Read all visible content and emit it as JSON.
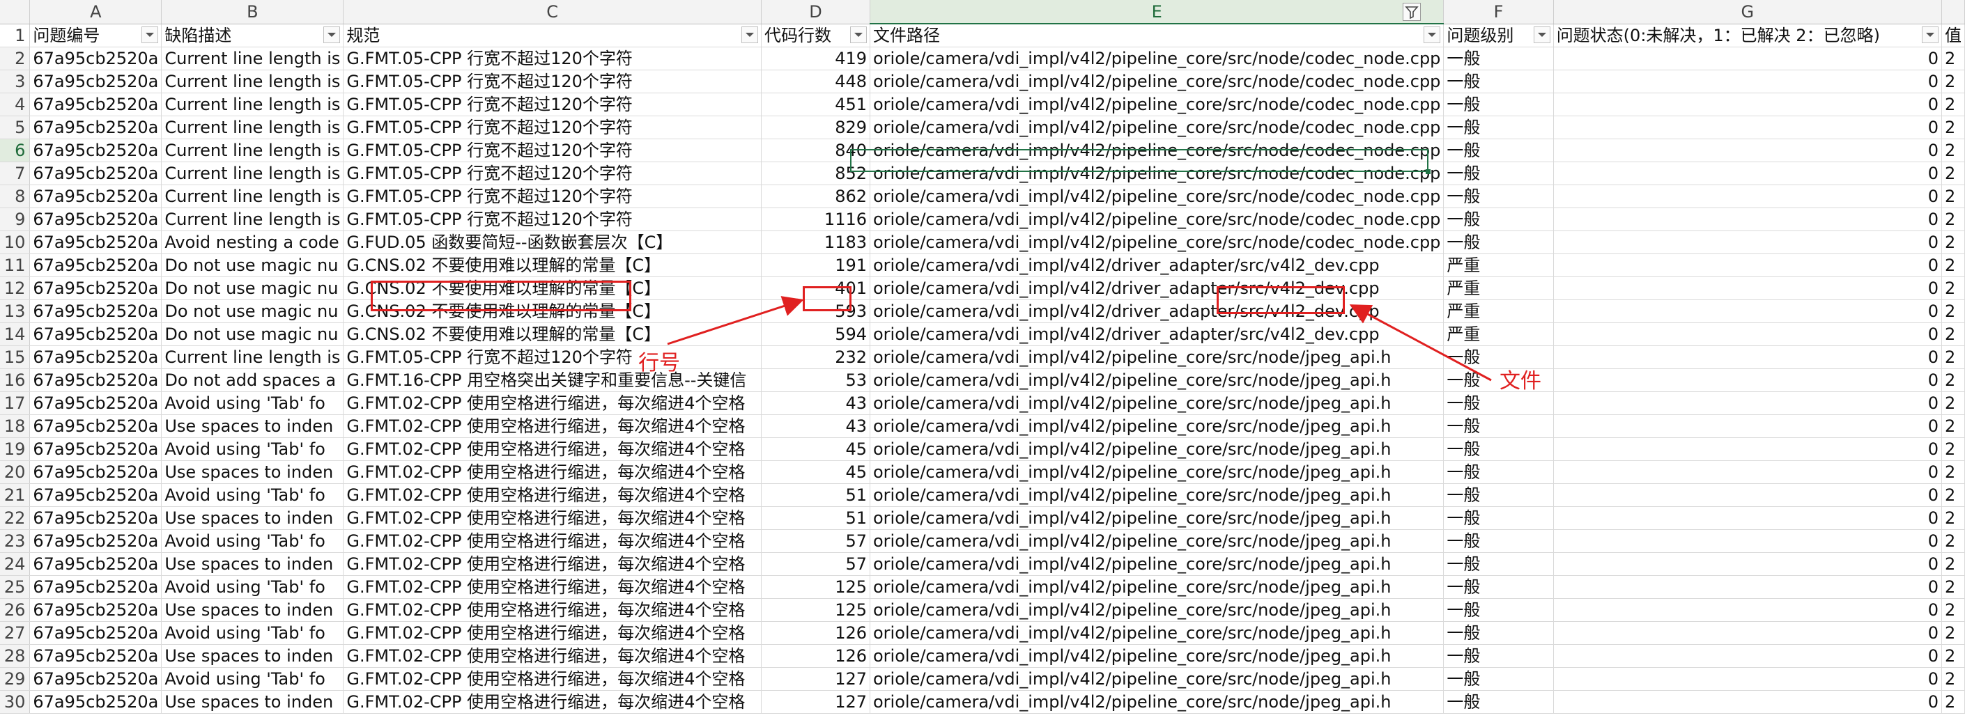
{
  "columns": [
    {
      "letter": "A"
    },
    {
      "letter": "B"
    },
    {
      "letter": "C"
    },
    {
      "letter": "D"
    },
    {
      "letter": "E"
    },
    {
      "letter": "F"
    },
    {
      "letter": "G"
    },
    {
      "letter": ""
    }
  ],
  "header_row": {
    "row_number": "1",
    "A": "问题编号",
    "B": "缺陷描述",
    "C": "规范",
    "D": "代码行数",
    "E": "文件路径",
    "F": "问题级别",
    "G": "问题状态(0:未解决，1：已解决 2：已忽略)",
    "H": "值"
  },
  "rows": [
    {
      "n": "2",
      "A": "67a95cb2520a",
      "B": "Current line length is",
      "C": "G.FMT.05-CPP 行宽不超过120个字符",
      "D": "419",
      "E": "oriole/camera/vdi_impl/v4l2/pipeline_core/src/node/codec_node.cpp",
      "F": "一般",
      "G": "0",
      "H": "2"
    },
    {
      "n": "3",
      "A": "67a95cb2520a",
      "B": "Current line length is",
      "C": "G.FMT.05-CPP 行宽不超过120个字符",
      "D": "448",
      "E": "oriole/camera/vdi_impl/v4l2/pipeline_core/src/node/codec_node.cpp",
      "F": "一般",
      "G": "0",
      "H": "2"
    },
    {
      "n": "4",
      "A": "67a95cb2520a",
      "B": "Current line length is",
      "C": "G.FMT.05-CPP 行宽不超过120个字符",
      "D": "451",
      "E": "oriole/camera/vdi_impl/v4l2/pipeline_core/src/node/codec_node.cpp",
      "F": "一般",
      "G": "0",
      "H": "2"
    },
    {
      "n": "5",
      "A": "67a95cb2520a",
      "B": "Current line length is",
      "C": "G.FMT.05-CPP 行宽不超过120个字符",
      "D": "829",
      "E": "oriole/camera/vdi_impl/v4l2/pipeline_core/src/node/codec_node.cpp",
      "F": "一般",
      "G": "0",
      "H": "2"
    },
    {
      "n": "6",
      "A": "67a95cb2520a",
      "B": "Current line length is",
      "C": "G.FMT.05-CPP 行宽不超过120个字符",
      "D": "840",
      "E": "oriole/camera/vdi_impl/v4l2/pipeline_core/src/node/codec_node.cpp",
      "F": "一般",
      "G": "0",
      "H": "2"
    },
    {
      "n": "7",
      "A": "67a95cb2520a",
      "B": "Current line length is",
      "C": "G.FMT.05-CPP 行宽不超过120个字符",
      "D": "852",
      "E": "oriole/camera/vdi_impl/v4l2/pipeline_core/src/node/codec_node.cpp",
      "F": "一般",
      "G": "0",
      "H": "2"
    },
    {
      "n": "8",
      "A": "67a95cb2520a",
      "B": "Current line length is",
      "C": "G.FMT.05-CPP 行宽不超过120个字符",
      "D": "862",
      "E": "oriole/camera/vdi_impl/v4l2/pipeline_core/src/node/codec_node.cpp",
      "F": "一般",
      "G": "0",
      "H": "2"
    },
    {
      "n": "9",
      "A": "67a95cb2520a",
      "B": "Current line length is",
      "C": "G.FMT.05-CPP 行宽不超过120个字符",
      "D": "1116",
      "E": "oriole/camera/vdi_impl/v4l2/pipeline_core/src/node/codec_node.cpp",
      "F": "一般",
      "G": "0",
      "H": "2"
    },
    {
      "n": "10",
      "A": "67a95cb2520a",
      "B": "Avoid nesting a code",
      "C": "G.FUD.05 函数要简短--函数嵌套层次【C】",
      "D": "1183",
      "E": "oriole/camera/vdi_impl/v4l2/pipeline_core/src/node/codec_node.cpp",
      "F": "一般",
      "G": "0",
      "H": "2"
    },
    {
      "n": "11",
      "A": "67a95cb2520a",
      "B": "Do not use magic nu",
      "C": "G.CNS.02 不要使用难以理解的常量【C】",
      "D": "191",
      "E": "oriole/camera/vdi_impl/v4l2/driver_adapter/src/v4l2_dev.cpp",
      "F": "严重",
      "G": "0",
      "H": "2"
    },
    {
      "n": "12",
      "A": "67a95cb2520a",
      "B": "Do not use magic nu",
      "C": "G.CNS.02 不要使用难以理解的常量【C】",
      "D": "401",
      "E": "oriole/camera/vdi_impl/v4l2/driver_adapter/src/v4l2_dev.cpp",
      "F": "严重",
      "G": "0",
      "H": "2"
    },
    {
      "n": "13",
      "A": "67a95cb2520a",
      "B": "Do not use magic nu",
      "C": "G.CNS.02 不要使用难以理解的常量【C】",
      "D": "593",
      "E": "oriole/camera/vdi_impl/v4l2/driver_adapter/src/v4l2_dev.cpp",
      "F": "严重",
      "G": "0",
      "H": "2"
    },
    {
      "n": "14",
      "A": "67a95cb2520a",
      "B": "Do not use magic nu",
      "C": "G.CNS.02 不要使用难以理解的常量【C】",
      "D": "594",
      "E": "oriole/camera/vdi_impl/v4l2/driver_adapter/src/v4l2_dev.cpp",
      "F": "严重",
      "G": "0",
      "H": "2"
    },
    {
      "n": "15",
      "A": "67a95cb2520a",
      "B": "Current line length is",
      "C": "G.FMT.05-CPP 行宽不超过120个字符",
      "D": "232",
      "E": "oriole/camera/vdi_impl/v4l2/pipeline_core/src/node/jpeg_api.h",
      "F": "一般",
      "G": "0",
      "H": "2"
    },
    {
      "n": "16",
      "A": "67a95cb2520a",
      "B": "Do not add spaces a",
      "C": "G.FMT.16-CPP 用空格突出关键字和重要信息--关键信",
      "D": "53",
      "E": "oriole/camera/vdi_impl/v4l2/pipeline_core/src/node/jpeg_api.h",
      "F": "一般",
      "G": "0",
      "H": "2"
    },
    {
      "n": "17",
      "A": "67a95cb2520a",
      "B": "Avoid using 'Tab' fo",
      "C": "G.FMT.02-CPP 使用空格进行缩进，每次缩进4个空格",
      "D": "43",
      "E": "oriole/camera/vdi_impl/v4l2/pipeline_core/src/node/jpeg_api.h",
      "F": "一般",
      "G": "0",
      "H": "2"
    },
    {
      "n": "18",
      "A": "67a95cb2520a",
      "B": "Use spaces to inden",
      "C": "G.FMT.02-CPP 使用空格进行缩进，每次缩进4个空格",
      "D": "43",
      "E": "oriole/camera/vdi_impl/v4l2/pipeline_core/src/node/jpeg_api.h",
      "F": "一般",
      "G": "0",
      "H": "2"
    },
    {
      "n": "19",
      "A": "67a95cb2520a",
      "B": "Avoid using 'Tab' fo",
      "C": "G.FMT.02-CPP 使用空格进行缩进，每次缩进4个空格",
      "D": "45",
      "E": "oriole/camera/vdi_impl/v4l2/pipeline_core/src/node/jpeg_api.h",
      "F": "一般",
      "G": "0",
      "H": "2"
    },
    {
      "n": "20",
      "A": "67a95cb2520a",
      "B": "Use spaces to inden",
      "C": "G.FMT.02-CPP 使用空格进行缩进，每次缩进4个空格",
      "D": "45",
      "E": "oriole/camera/vdi_impl/v4l2/pipeline_core/src/node/jpeg_api.h",
      "F": "一般",
      "G": "0",
      "H": "2"
    },
    {
      "n": "21",
      "A": "67a95cb2520a",
      "B": "Avoid using 'Tab' fo",
      "C": "G.FMT.02-CPP 使用空格进行缩进，每次缩进4个空格",
      "D": "51",
      "E": "oriole/camera/vdi_impl/v4l2/pipeline_core/src/node/jpeg_api.h",
      "F": "一般",
      "G": "0",
      "H": "2"
    },
    {
      "n": "22",
      "A": "67a95cb2520a",
      "B": "Use spaces to inden",
      "C": "G.FMT.02-CPP 使用空格进行缩进，每次缩进4个空格",
      "D": "51",
      "E": "oriole/camera/vdi_impl/v4l2/pipeline_core/src/node/jpeg_api.h",
      "F": "一般",
      "G": "0",
      "H": "2"
    },
    {
      "n": "23",
      "A": "67a95cb2520a",
      "B": "Avoid using 'Tab' fo",
      "C": "G.FMT.02-CPP 使用空格进行缩进，每次缩进4个空格",
      "D": "57",
      "E": "oriole/camera/vdi_impl/v4l2/pipeline_core/src/node/jpeg_api.h",
      "F": "一般",
      "G": "0",
      "H": "2"
    },
    {
      "n": "24",
      "A": "67a95cb2520a",
      "B": "Use spaces to inden",
      "C": "G.FMT.02-CPP 使用空格进行缩进，每次缩进4个空格",
      "D": "57",
      "E": "oriole/camera/vdi_impl/v4l2/pipeline_core/src/node/jpeg_api.h",
      "F": "一般",
      "G": "0",
      "H": "2"
    },
    {
      "n": "25",
      "A": "67a95cb2520a",
      "B": "Avoid using 'Tab' fo",
      "C": "G.FMT.02-CPP 使用空格进行缩进，每次缩进4个空格",
      "D": "125",
      "E": "oriole/camera/vdi_impl/v4l2/pipeline_core/src/node/jpeg_api.h",
      "F": "一般",
      "G": "0",
      "H": "2"
    },
    {
      "n": "26",
      "A": "67a95cb2520a",
      "B": "Use spaces to inden",
      "C": "G.FMT.02-CPP 使用空格进行缩进，每次缩进4个空格",
      "D": "125",
      "E": "oriole/camera/vdi_impl/v4l2/pipeline_core/src/node/jpeg_api.h",
      "F": "一般",
      "G": "0",
      "H": "2"
    },
    {
      "n": "27",
      "A": "67a95cb2520a",
      "B": "Avoid using 'Tab' fo",
      "C": "G.FMT.02-CPP 使用空格进行缩进，每次缩进4个空格",
      "D": "126",
      "E": "oriole/camera/vdi_impl/v4l2/pipeline_core/src/node/jpeg_api.h",
      "F": "一般",
      "G": "0",
      "H": "2"
    },
    {
      "n": "28",
      "A": "67a95cb2520a",
      "B": "Use spaces to inden",
      "C": "G.FMT.02-CPP 使用空格进行缩进，每次缩进4个空格",
      "D": "126",
      "E": "oriole/camera/vdi_impl/v4l2/pipeline_core/src/node/jpeg_api.h",
      "F": "一般",
      "G": "0",
      "H": "2"
    },
    {
      "n": "29",
      "A": "67a95cb2520a",
      "B": "Avoid using 'Tab' fo",
      "C": "G.FMT.02-CPP 使用空格进行缩进，每次缩进4个空格",
      "D": "127",
      "E": "oriole/camera/vdi_impl/v4l2/pipeline_core/src/node/jpeg_api.h",
      "F": "一般",
      "G": "0",
      "H": "2"
    },
    {
      "n": "30",
      "A": "67a95cb2520a",
      "B": "Use spaces to inden",
      "C": "G.FMT.02-CPP 使用空格进行缩进，每次缩进4个空格",
      "D": "127",
      "E": "oriole/camera/vdi_impl/v4l2/pipeline_core/src/node/jpeg_api.h",
      "F": "一般",
      "G": "0",
      "H": "2"
    }
  ],
  "annotations": {
    "line_label": "行号",
    "file_label": "文件"
  },
  "colors": {
    "annotation": "#e02020",
    "selection": "#217346",
    "header_bg": "#f3f3f3",
    "gridline": "#dadada"
  },
  "icons": {
    "filter_dropdown": "chevron-down-icon",
    "filter_active": "funnel-icon"
  }
}
